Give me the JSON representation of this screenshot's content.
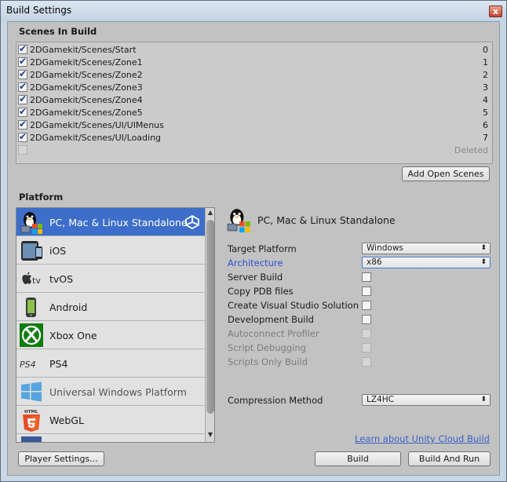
{
  "window": {
    "title": "Build Settings",
    "close_glyph": "x"
  },
  "scenes": {
    "section_title": "Scenes In Build",
    "items": [
      {
        "name": "2DGamekit/Scenes/Start",
        "index": "0",
        "checked": true
      },
      {
        "name": "2DGamekit/Scenes/Zone1",
        "index": "1",
        "checked": true
      },
      {
        "name": "2DGamekit/Scenes/Zone2",
        "index": "2",
        "checked": true
      },
      {
        "name": "2DGamekit/Scenes/Zone3",
        "index": "3",
        "checked": true
      },
      {
        "name": "2DGamekit/Scenes/Zone4",
        "index": "4",
        "checked": true
      },
      {
        "name": "2DGamekit/Scenes/Zone5",
        "index": "5",
        "checked": true
      },
      {
        "name": "2DGamekit/Scenes/UI/UIMenus",
        "index": "6",
        "checked": true
      },
      {
        "name": "2DGamekit/Scenes/UI/Loading",
        "index": "7",
        "checked": true
      }
    ],
    "deleted_row": {
      "name": "",
      "index": "Deleted",
      "checked": false
    },
    "add_open_scenes_label": "Add Open Scenes"
  },
  "platform": {
    "section_title": "Platform",
    "items": [
      {
        "label": "PC, Mac & Linux Standalone",
        "icon": "pc-mac-linux-icon",
        "selected": true
      },
      {
        "label": "iOS",
        "icon": "ios-icon",
        "selected": false
      },
      {
        "label": "tvOS",
        "icon": "tvos-icon",
        "selected": false
      },
      {
        "label": "Android",
        "icon": "android-icon",
        "selected": false
      },
      {
        "label": "Xbox One",
        "icon": "xbox-icon",
        "selected": false
      },
      {
        "label": "PS4",
        "icon": "ps4-icon",
        "selected": false
      },
      {
        "label": "Universal Windows Platform",
        "icon": "windows-icon",
        "selected": false
      },
      {
        "label": "WebGL",
        "icon": "html5-icon",
        "selected": false
      }
    ],
    "tvos_text": "tv",
    "ps4_text": "PS4",
    "html5_text": "HTML"
  },
  "settings": {
    "title": "PC, Mac & Linux Standalone",
    "target_platform_label": "Target Platform",
    "target_platform_value": "Windows",
    "architecture_label": "Architecture",
    "architecture_value": "x86",
    "server_build_label": "Server Build",
    "copy_pdb_label": "Copy PDB files",
    "create_vs_label": "Create Visual Studio Solution",
    "development_build_label": "Development Build",
    "autoconnect_label": "Autoconnect Profiler",
    "script_debugging_label": "Script Debugging",
    "scripts_only_label": "Scripts Only Build",
    "compression_label": "Compression Method",
    "compression_value": "LZ4HC"
  },
  "footer": {
    "cloud_link": "Learn about Unity Cloud Build",
    "player_settings_label": "Player Settings...",
    "build_label": "Build",
    "build_and_run_label": "Build And Run"
  },
  "colors": {
    "selection": "#3d6ec9",
    "link": "#3b61c5",
    "accent_label": "#2b4fd2"
  }
}
